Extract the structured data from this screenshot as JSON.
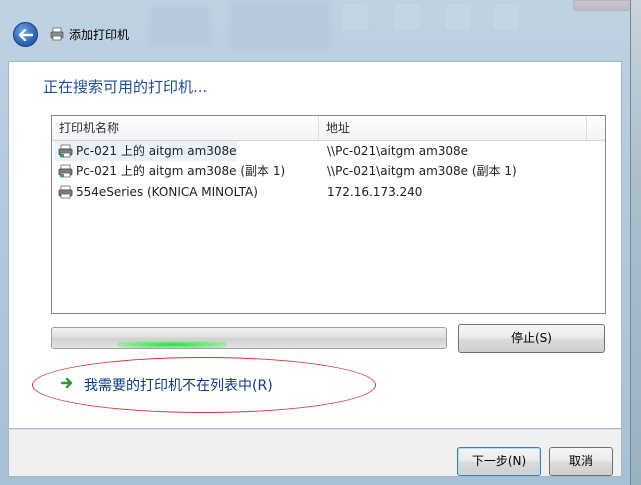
{
  "window": {
    "title": "添加打印机"
  },
  "main": {
    "heading": "正在搜索可用的打印机...",
    "columns": [
      "打印机名称",
      "地址"
    ],
    "printers": [
      {
        "name": "Pc-021 上的 aitgm am308e",
        "address": "\\\\Pc-021\\aitgm am308e"
      },
      {
        "name": "Pc-021 上的 aitgm am308e (副本 1)",
        "address": "\\\\Pc-021\\aitgm am308e (副本 1)"
      },
      {
        "name": "554eSeries (KONICA MINOLTA)",
        "address": "172.16.173.240"
      }
    ],
    "stop_button": "停止(S)",
    "not_listed_link": "我需要的打印机不在列表中(R)"
  },
  "footer": {
    "next_button": "下一步(N)",
    "cancel_button": "取消"
  },
  "icons": {
    "back": "back-arrow-icon",
    "title": "printer-icon",
    "row": "printer-icon",
    "link": "green-arrow-icon"
  },
  "colors": {
    "heading": "#1f4f93",
    "link": "#0c3a86",
    "highlight_ellipse": "#d8343a",
    "progress_glow": "#27d844"
  }
}
